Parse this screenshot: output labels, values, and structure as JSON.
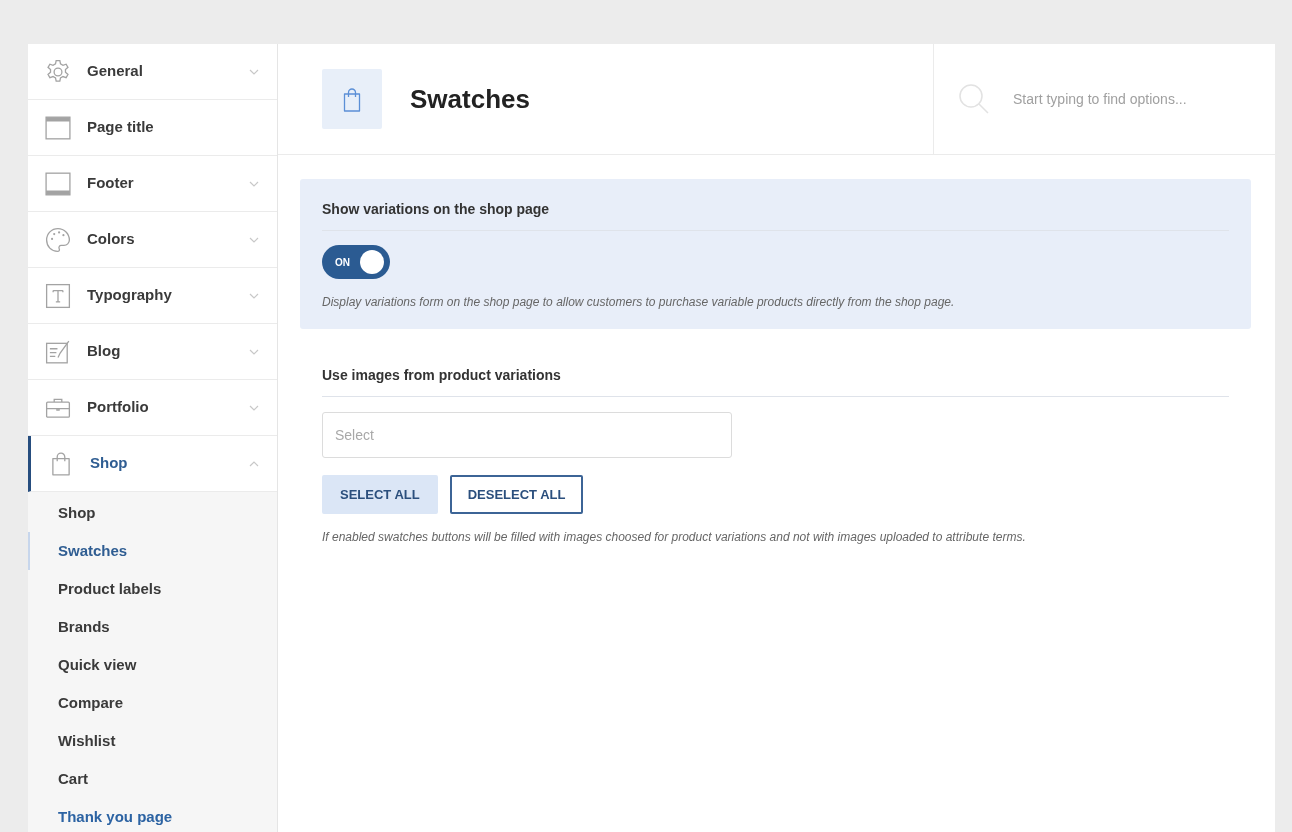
{
  "sidebar": {
    "items": [
      {
        "label": "General",
        "has_submenu": true,
        "expanded": false,
        "selected": false
      },
      {
        "label": "Page title",
        "has_submenu": false,
        "selected": false
      },
      {
        "label": "Footer",
        "has_submenu": true,
        "expanded": false,
        "selected": false
      },
      {
        "label": "Colors",
        "has_submenu": true,
        "expanded": false,
        "selected": false
      },
      {
        "label": "Typography",
        "has_submenu": true,
        "expanded": false,
        "selected": false
      },
      {
        "label": "Blog",
        "has_submenu": true,
        "expanded": false,
        "selected": false
      },
      {
        "label": "Portfolio",
        "has_submenu": true,
        "expanded": false,
        "selected": false
      },
      {
        "label": "Shop",
        "has_submenu": true,
        "expanded": true,
        "selected": true,
        "children": [
          {
            "label": "Shop",
            "selected": false,
            "hovered": false
          },
          {
            "label": "Swatches",
            "selected": true,
            "hovered": false
          },
          {
            "label": "Product labels",
            "selected": false,
            "hovered": false
          },
          {
            "label": "Brands",
            "selected": false,
            "hovered": false
          },
          {
            "label": "Quick view",
            "selected": false,
            "hovered": false
          },
          {
            "label": "Compare",
            "selected": false,
            "hovered": false
          },
          {
            "label": "Wishlist",
            "selected": false,
            "hovered": false
          },
          {
            "label": "Cart",
            "selected": false,
            "hovered": false
          },
          {
            "label": "Thank you page",
            "selected": false,
            "hovered": true
          }
        ]
      }
    ]
  },
  "header": {
    "title": "Swatches",
    "search": {
      "placeholder": "Start typing to find options..."
    }
  },
  "sections": [
    {
      "kind": "toggle",
      "highlighted": true,
      "title": "Show variations on the shop page",
      "toggle": {
        "on": true,
        "label": "ON"
      },
      "description": "Display variations form on the shop page to allow customers to purchase variable products directly from the shop page."
    },
    {
      "kind": "multiselect",
      "highlighted": false,
      "title": "Use images from product variations",
      "select": {
        "placeholder": "Select"
      },
      "buttons": [
        {
          "label": "SELECT ALL",
          "kind": "filled"
        },
        {
          "label": "DESELECT ALL",
          "kind": "outline"
        }
      ],
      "description": "If enabled swatches buttons will be filled with images choosed for product variations and not with images uploaded to attribute terms."
    }
  ]
}
